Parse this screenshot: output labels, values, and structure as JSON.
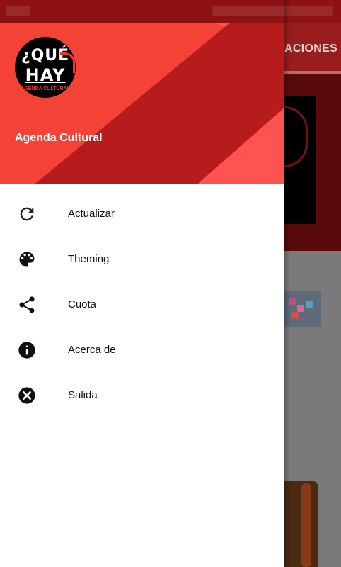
{
  "app": {
    "tab_partial": "ACIONES"
  },
  "drawer": {
    "header": {
      "logo_text_top": "¿QUÉ",
      "logo_text_bottom": "HAY",
      "logo_subtitle": "AGENDA CULTURAL",
      "title": "Agenda Cultural"
    },
    "items": [
      {
        "label": "Actualizar",
        "icon": "refresh-icon"
      },
      {
        "label": "Theming",
        "icon": "palette-icon"
      },
      {
        "label": "Cuota",
        "icon": "share-icon"
      },
      {
        "label": "Acerca de",
        "icon": "info-icon"
      },
      {
        "label": "Salida",
        "icon": "close-circle-icon"
      }
    ]
  },
  "colors": {
    "primary": "#f44336",
    "primary_dark": "#b71c1c",
    "accent": "#ff5252"
  }
}
